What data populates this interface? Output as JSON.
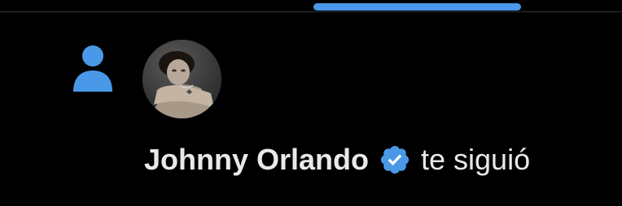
{
  "notification": {
    "type_icon": "person-icon",
    "user": {
      "name": "Johnny Orlando",
      "verified": true,
      "avatar": "profile-photo"
    },
    "action": "te siguió"
  },
  "colors": {
    "background": "#000000",
    "accent": "#4a99e9",
    "text": "#e7e9ea",
    "verified_badge": "#4a99e9"
  }
}
